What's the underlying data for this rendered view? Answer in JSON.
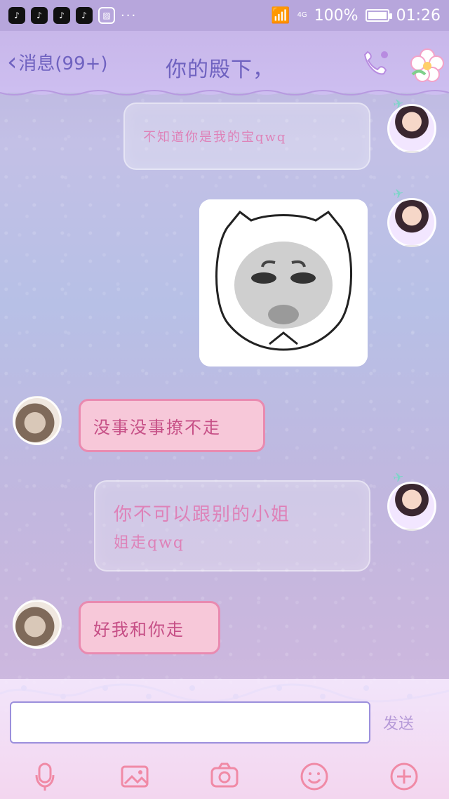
{
  "status_bar": {
    "icons": [
      "tiktok-icon",
      "tiktok-icon",
      "tiktok-icon",
      "tiktok-icon",
      "image-icon",
      "more-icon"
    ],
    "network": "4G",
    "battery": "100%",
    "time": "01:26"
  },
  "header": {
    "back_label": "消息(99+)",
    "title": "你的殿下，"
  },
  "messages": [
    {
      "from": "me",
      "type": "text",
      "text": "不知道你是我的宝qwq"
    },
    {
      "from": "me",
      "type": "sticker"
    },
    {
      "from": "them",
      "type": "text",
      "text": "没事没事撩不走"
    },
    {
      "from": "me",
      "type": "text",
      "text_line1": "你不可以跟别的小姐",
      "text_line2": "姐走qwq"
    },
    {
      "from": "them",
      "type": "text",
      "text": "好我和你走"
    }
  ],
  "composer": {
    "send_label": "发送",
    "placeholder": ""
  },
  "toolbar": [
    "mic-icon",
    "image-icon",
    "camera-icon",
    "emoji-icon",
    "plus-icon"
  ],
  "colors": {
    "header_text": "#6f62c0",
    "bubble_text": "#c64f86",
    "accent_pink": "#f08aa6"
  }
}
